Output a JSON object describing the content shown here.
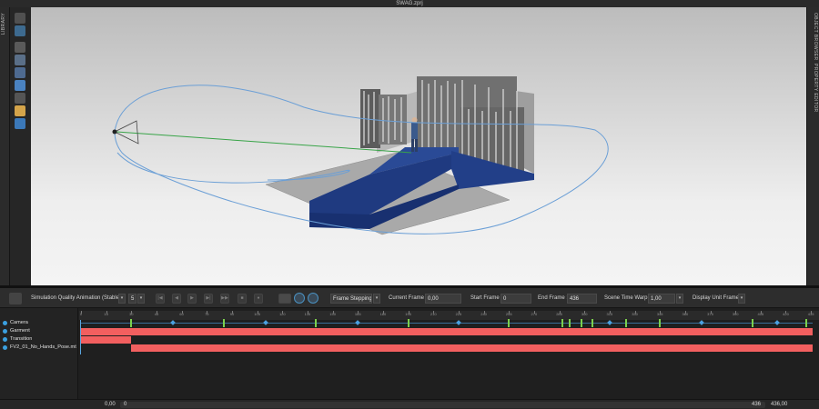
{
  "window": {
    "title": "SWAG.zprj"
  },
  "side_panels": {
    "left": "LIBRARY",
    "right_top": "OBJECT BROWSER",
    "right_bottom": "PROPERTY EDITOR"
  },
  "tools": [
    "select-icon",
    "move-gizmo-icon",
    "transform-icon",
    "avatar-icon",
    "garment-icon",
    "camera-icon",
    "light-icon",
    "render-icon",
    "pose-icon",
    "sun-icon",
    "zoom-icon"
  ],
  "toolbar": {
    "sim_quality": "Simulation Quality Animation (Stable",
    "sim_value": "5",
    "frame_stepping": "Frame Stepping",
    "current_frame_label": "Current Frame :",
    "current_frame_value": "0,00",
    "start_frame_label": "Start Frame :",
    "start_frame_value": "0",
    "end_frame_label": "End Frame :",
    "end_frame_value": "436",
    "scene_time_warp_label": "Scene Time Warp",
    "scene_time_warp_value": "1,00",
    "display_unit": "Display Unit Frame"
  },
  "timeline": {
    "tracks": [
      {
        "name": "Camera"
      },
      {
        "name": "Garment"
      },
      {
        "name": "Transition"
      },
      {
        "name": "FV2_01_No_Hands_Pose.mt"
      }
    ],
    "ruler_ticks": [
      "0",
      "15",
      "30",
      "45",
      "60",
      "75",
      "90",
      "105",
      "120",
      "135",
      "150",
      "165",
      "180",
      "195",
      "210",
      "225",
      "240",
      "255",
      "270",
      "285",
      "300",
      "315",
      "330",
      "345",
      "360",
      "375",
      "390",
      "405",
      "420",
      "435"
    ],
    "frame_max": 436,
    "camera_keyframes": [
      30,
      85,
      140,
      195,
      255,
      287,
      291,
      298,
      305,
      325,
      345,
      400,
      432
    ],
    "camera_diamonds": [
      55,
      110,
      165,
      225,
      315,
      370,
      415
    ],
    "transition_end_frame": 30,
    "pose_start_frame": 30,
    "colors": {
      "track_bar": "#f25f5f",
      "keyframe": "#7bd04d",
      "accent": "#3ba0e0"
    }
  },
  "bottom": {
    "left_value": "0,00",
    "start": "0",
    "end": "436",
    "right_value": "436,00"
  }
}
